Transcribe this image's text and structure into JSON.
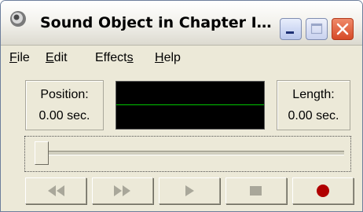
{
  "window": {
    "title": "Sound Object in Chapter I…"
  },
  "titlebar_icons": {
    "app": "speaker-icon",
    "minimize": "minimize-icon",
    "maximize": "maximize-icon",
    "close": "close-icon"
  },
  "menu": {
    "items": [
      {
        "accel": "F",
        "rest": "ile"
      },
      {
        "accel": "E",
        "rest": "dit"
      },
      {
        "pre": "Effect",
        "accel": "s"
      },
      {
        "accel": "H",
        "rest": "elp"
      }
    ]
  },
  "position": {
    "label": "Position:",
    "value": "0.00 sec."
  },
  "length": {
    "label": "Length:",
    "value": "0.00 sec."
  },
  "scope": {
    "background": "#000000",
    "wave_color": "#00c400"
  },
  "slider": {
    "fraction": 0
  },
  "controls": {
    "seek_back": "seek-back-icon",
    "seek_forward": "seek-forward-icon",
    "play": "play-icon",
    "stop": "stop-icon",
    "record": "record-icon",
    "disabled_color": "#a9a79a",
    "record_color": "#b00000"
  }
}
